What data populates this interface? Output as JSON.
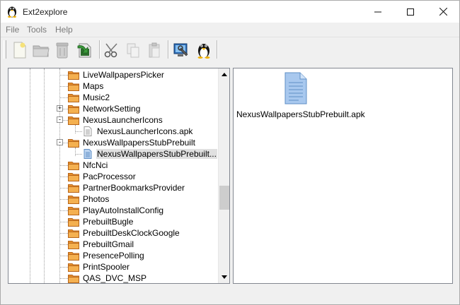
{
  "window": {
    "title": "Ext2explore"
  },
  "menu": [
    "File",
    "Tools",
    "Help"
  ],
  "toolbar": {
    "buttons": [
      "new-file-icon",
      "open-folder-icon",
      "delete-icon",
      "save-icon",
      "cut-icon",
      "copy-icon",
      "paste-icon",
      "settings-icon",
      "linux-icon"
    ]
  },
  "tree": {
    "rows": [
      {
        "label": "LiveWallpapersPicker",
        "type": "folder",
        "expander": ""
      },
      {
        "label": "Maps",
        "type": "folder",
        "expander": ""
      },
      {
        "label": "Music2",
        "type": "folder",
        "expander": ""
      },
      {
        "label": "NetworkSetting",
        "type": "folder",
        "expander": "+"
      },
      {
        "label": "NexusLauncherIcons",
        "type": "folder",
        "expander": "-"
      },
      {
        "label": "NexusLauncherIcons.apk",
        "type": "file",
        "expander": ""
      },
      {
        "label": "NexusWallpapersStubPrebuilt",
        "type": "folder",
        "expander": "-"
      },
      {
        "label": "NexusWallpapersStubPrebuilt...",
        "type": "file-selected",
        "expander": ""
      },
      {
        "label": "NfcNci",
        "type": "folder",
        "expander": ""
      },
      {
        "label": "PacProcessor",
        "type": "folder",
        "expander": ""
      },
      {
        "label": "PartnerBookmarksProvider",
        "type": "folder",
        "expander": ""
      },
      {
        "label": "Photos",
        "type": "folder",
        "expander": ""
      },
      {
        "label": "PlayAutoInstallConfig",
        "type": "folder",
        "expander": ""
      },
      {
        "label": "PrebuiltBugle",
        "type": "folder",
        "expander": ""
      },
      {
        "label": "PrebuiltDeskClockGoogle",
        "type": "folder",
        "expander": ""
      },
      {
        "label": "PrebuiltGmail",
        "type": "folder",
        "expander": ""
      },
      {
        "label": "PresencePolling",
        "type": "folder",
        "expander": ""
      },
      {
        "label": "PrintSpooler",
        "type": "folder",
        "expander": ""
      },
      {
        "label": "QAS_DVC_MSP",
        "type": "folder",
        "expander": ""
      }
    ]
  },
  "files": [
    {
      "label": "NexusWallpapersStubPrebuilt.apk",
      "icon": "document-icon"
    }
  ]
}
